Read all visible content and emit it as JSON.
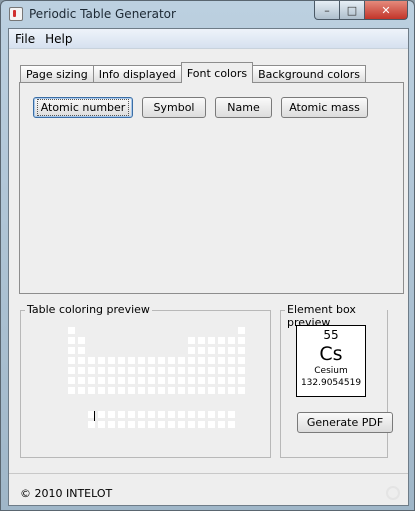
{
  "window": {
    "title": "Periodic Table Generator",
    "min_glyph": "–",
    "max_glyph": "□",
    "close_glyph": "✕"
  },
  "menu": [
    "File",
    "Help"
  ],
  "tabs": [
    "Page sizing",
    "Info displayed",
    "Font colors",
    "Background colors"
  ],
  "active_tab": "Font colors",
  "buttons": [
    "Atomic number",
    "Symbol",
    "Name",
    "Atomic mass"
  ],
  "preview": {
    "label": "Table coloring preview"
  },
  "element_box": {
    "label": "Element box preview",
    "number": "55",
    "symbol": "Cs",
    "name": "Cesium",
    "mass": "132.9054519"
  },
  "generate_label": "Generate PDF",
  "status": {
    "copyright": "© 2010 INTELOT"
  }
}
